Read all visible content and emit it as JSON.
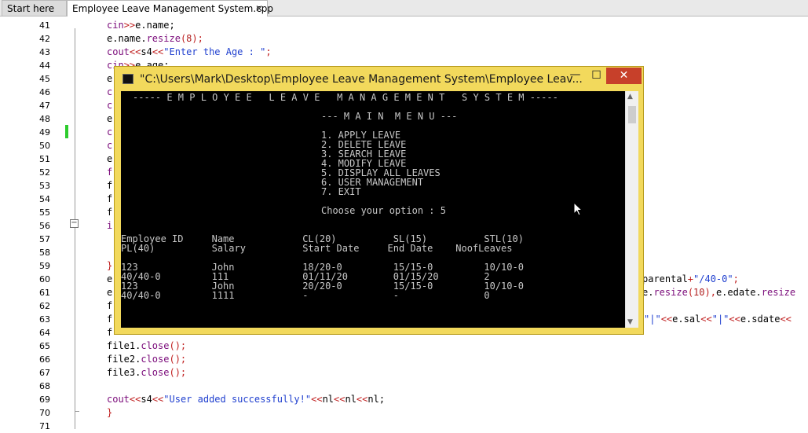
{
  "tabs": [
    {
      "label": "Start here"
    },
    {
      "label": "Employee Leave Management System.cpp",
      "close": "✕"
    }
  ],
  "code_lines": [
    {
      "n": "41",
      "segs": [
        [
          "cin",
          "kw"
        ],
        [
          ">>",
          "op"
        ],
        [
          "e.name;",
          ""
        ]
      ]
    },
    {
      "n": "42",
      "segs": [
        [
          "e.name.",
          ""
        ],
        [
          "resize",
          "kw"
        ],
        [
          "(",
          "op"
        ],
        [
          "8",
          "num"
        ],
        [
          ");",
          "op"
        ]
      ]
    },
    {
      "n": "43",
      "segs": [
        [
          "cout",
          "kw"
        ],
        [
          "<<",
          "op"
        ],
        [
          "s4",
          ""
        ],
        [
          "<<",
          "op"
        ],
        [
          "\"Enter the Age : \"",
          "str"
        ],
        [
          ";",
          "op"
        ]
      ]
    },
    {
      "n": "44",
      "segs": [
        [
          "cin",
          "kw"
        ],
        [
          ">>",
          "op"
        ],
        [
          "e.age;",
          ""
        ]
      ]
    },
    {
      "n": "45",
      "segs": [
        [
          "e",
          ""
        ]
      ]
    },
    {
      "n": "46",
      "segs": [
        [
          "c",
          "kw"
        ]
      ]
    },
    {
      "n": "47",
      "segs": [
        [
          "c",
          "kw"
        ]
      ]
    },
    {
      "n": "48",
      "segs": [
        [
          "e",
          ""
        ]
      ]
    },
    {
      "n": "49",
      "segs": [
        [
          "c",
          "kw"
        ]
      ]
    },
    {
      "n": "50",
      "segs": [
        [
          "c",
          "kw"
        ]
      ]
    },
    {
      "n": "51",
      "segs": [
        [
          "e",
          ""
        ]
      ]
    },
    {
      "n": "52",
      "segs": [
        [
          "f",
          "kw"
        ]
      ]
    },
    {
      "n": "53",
      "segs": [
        [
          "f",
          ""
        ]
      ]
    },
    {
      "n": "54",
      "segs": [
        [
          "f",
          ""
        ]
      ]
    },
    {
      "n": "55",
      "segs": [
        [
          "f",
          ""
        ]
      ]
    },
    {
      "n": "56",
      "segs": [
        [
          "i",
          "kw"
        ]
      ]
    },
    {
      "n": "57",
      "segs": []
    },
    {
      "n": "58",
      "segs": []
    },
    {
      "n": "59",
      "segs": [
        [
          "}",
          "op"
        ]
      ]
    },
    {
      "n": "60",
      "segs": [
        [
          "e",
          ""
        ]
      ]
    },
    {
      "n": "61",
      "segs": [
        [
          "e",
          ""
        ]
      ]
    },
    {
      "n": "62",
      "segs": [
        [
          "f",
          ""
        ]
      ]
    },
    {
      "n": "63",
      "segs": [
        [
          "f",
          ""
        ]
      ]
    },
    {
      "n": "64",
      "segs": [
        [
          "f",
          ""
        ]
      ]
    },
    {
      "n": "65",
      "segs": [
        [
          "file1.",
          ""
        ],
        [
          "close",
          "kw"
        ],
        [
          "();",
          "op"
        ]
      ]
    },
    {
      "n": "66",
      "segs": [
        [
          "file2.",
          ""
        ],
        [
          "close",
          "kw"
        ],
        [
          "();",
          "op"
        ]
      ]
    },
    {
      "n": "67",
      "segs": [
        [
          "file3.",
          ""
        ],
        [
          "close",
          "kw"
        ],
        [
          "();",
          "op"
        ]
      ]
    },
    {
      "n": "68",
      "segs": []
    },
    {
      "n": "69",
      "segs": [
        [
          "cout",
          "kw"
        ],
        [
          "<<",
          "op"
        ],
        [
          "s4",
          ""
        ],
        [
          "<<",
          "op"
        ],
        [
          "\"User added successfully!\"",
          "str"
        ],
        [
          "<<",
          "op"
        ],
        [
          "nl",
          ""
        ],
        [
          "<<",
          "op"
        ],
        [
          "nl",
          ""
        ],
        [
          "<<",
          "op"
        ],
        [
          "nl;",
          ""
        ]
      ]
    },
    {
      "n": "70",
      "segs": [
        [
          "}",
          "op"
        ]
      ]
    },
    {
      "n": "71",
      "segs": []
    }
  ],
  "right_fragments": [
    {
      "line": 60,
      "segs": [
        [
          "parental",
          ""
        ],
        [
          "+",
          "op"
        ],
        [
          "\"/40-0\"",
          "str"
        ],
        [
          ";",
          "op"
        ]
      ]
    },
    {
      "line": 61,
      "segs": [
        [
          "e.",
          ""
        ],
        [
          "resize",
          "kw"
        ],
        [
          "(",
          "op"
        ],
        [
          "10",
          "num"
        ],
        [
          "),",
          "op"
        ],
        [
          "e.edate.",
          ""
        ],
        [
          "resize",
          "kw"
        ]
      ]
    },
    {
      "line": 63,
      "segs": [
        [
          "\"|\"",
          "str"
        ],
        [
          "<<",
          "op"
        ],
        [
          "e.sal",
          ""
        ],
        [
          "<<",
          "op"
        ],
        [
          "\"|\"",
          "str"
        ],
        [
          "<<",
          "op"
        ],
        [
          "e.sdate",
          ""
        ],
        [
          "<<",
          "op"
        ]
      ]
    }
  ],
  "console": {
    "title": "\"C:\\Users\\Mark\\Desktop\\Employee Leave Management System\\Employee Leav...",
    "buttons": {
      "minimize": "—",
      "maximize": "☐",
      "close": "✕"
    },
    "lines": [
      "----- E M P L O Y E E   L E A V E   M A N A G E M E N T   S Y S T E M -----",
      "--- M A I N  M E N U ---",
      "1. APPLY LEAVE",
      "2. DELETE LEAVE",
      "3. SEARCH LEAVE",
      "4. MODIFY LEAVE",
      "5. DISPLAY ALL LEAVES",
      "6. USER MANAGEMENT",
      "7. EXIT",
      "Choose your option : 5",
      "Employee ID     Name            CL(20)          SL(15)          STL(10)",
      "PL(40)          Salary          Start Date     End Date    NoofLeaves",
      "123             John            18/20-0         15/15-0         10/10-0",
      "40/40-0         111             01/11/20        01/15/20        2",
      "123             John            20/20-0         15/15-0         10/10-0",
      "40/40-0         1111            -               -               0"
    ]
  }
}
